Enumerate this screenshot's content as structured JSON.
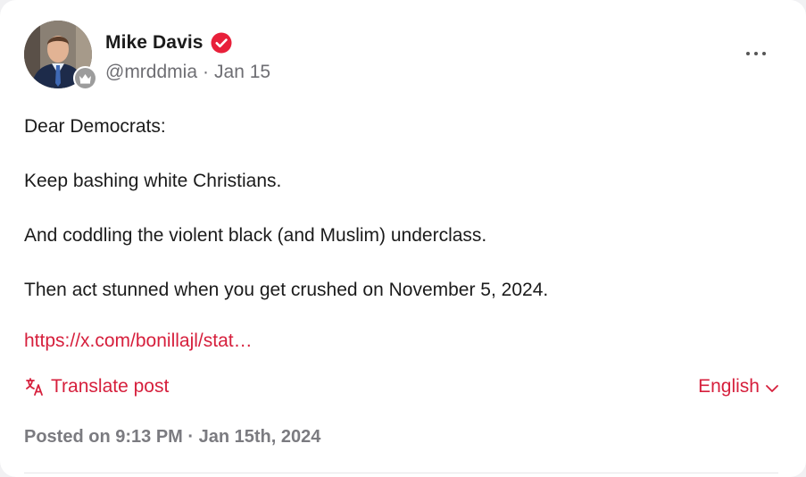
{
  "author": {
    "display_name": "Mike Davis",
    "handle": "@mrddmia",
    "separator": "·",
    "date": "Jan 15"
  },
  "icons": {
    "verified": "verified-check-icon",
    "crown": "crown-badge-icon",
    "more": "more-options-icon",
    "translate": "translate-icon",
    "chevron": "chevron-down-icon"
  },
  "colors": {
    "accent": "#d61f3c",
    "text": "#1b1b1b",
    "muted": "#6e6e73"
  },
  "post": {
    "paragraphs": [
      "Dear Democrats:",
      "Keep bashing white Christians.",
      "And coddling the violent black (and Muslim) underclass.",
      "Then act stunned when you get crushed on November 5, 2024."
    ],
    "link_text": "https://x.com/bonillajl/stat…"
  },
  "actions": {
    "translate_label": "Translate post",
    "language_label": "English"
  },
  "footer": {
    "posted_text": "Posted on 9:13 PM · Jan 15th, 2024"
  }
}
